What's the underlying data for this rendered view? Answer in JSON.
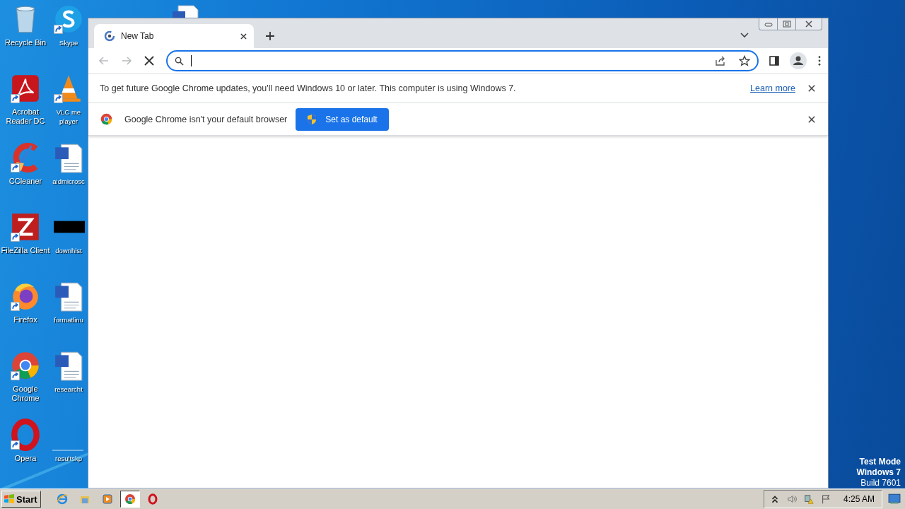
{
  "desktop": {
    "icons": [
      {
        "label": "Recycle Bin",
        "kind": "recycle",
        "shortcut": false
      },
      {
        "label": "Acrobat Reader DC",
        "kind": "acrobat",
        "shortcut": true
      },
      {
        "label": "CCleaner",
        "kind": "ccleaner",
        "shortcut": true
      },
      {
        "label": "FileZilla Client",
        "kind": "filezilla",
        "shortcut": true
      },
      {
        "label": "Firefox",
        "kind": "firefox",
        "shortcut": true
      },
      {
        "label": "Google Chrome",
        "kind": "chrome",
        "shortcut": true
      },
      {
        "label": "Opera",
        "kind": "opera",
        "shortcut": true
      },
      {
        "label": "Skype",
        "kind": "skype",
        "shortcut": true
      },
      {
        "label": "VLC me player",
        "kind": "vlc",
        "shortcut": true
      },
      {
        "label": "aidmicrosc",
        "kind": "word",
        "shortcut": false
      },
      {
        "label": "downhist",
        "kind": "black",
        "shortcut": false
      },
      {
        "label": "formatlinu",
        "kind": "word",
        "shortcut": false
      },
      {
        "label": "researcht",
        "kind": "word",
        "shortcut": false
      },
      {
        "label": "resultskp",
        "kind": "blank",
        "shortcut": false
      }
    ],
    "test_mode": [
      "Test Mode",
      "Windows 7",
      "Build 7601"
    ]
  },
  "browser": {
    "tabs": [
      {
        "title": "New Tab",
        "selected": true
      }
    ],
    "nav": [
      {
        "kind": "back",
        "disabled": true
      },
      {
        "kind": "forward",
        "disabled": true
      },
      {
        "kind": "stop",
        "disabled": false
      }
    ],
    "infobars": [
      {
        "kind": "update",
        "message": "To get future Google Chrome updates, you'll need Windows 10 or later. This computer is using Windows 7.",
        "link": "Learn more"
      },
      {
        "kind": "default_browser",
        "message": "Google Chrome isn't your default browser",
        "button": "Set as default"
      }
    ]
  },
  "taskbar": {
    "start": "Start",
    "apps": [
      {
        "kind": "ie",
        "selected": false
      },
      {
        "kind": "explorer",
        "selected": false
      },
      {
        "kind": "media",
        "selected": false
      },
      {
        "kind": "chrome",
        "selected": true
      },
      {
        "kind": "opera",
        "selected": false
      }
    ],
    "clock": "4:25 AM"
  }
}
